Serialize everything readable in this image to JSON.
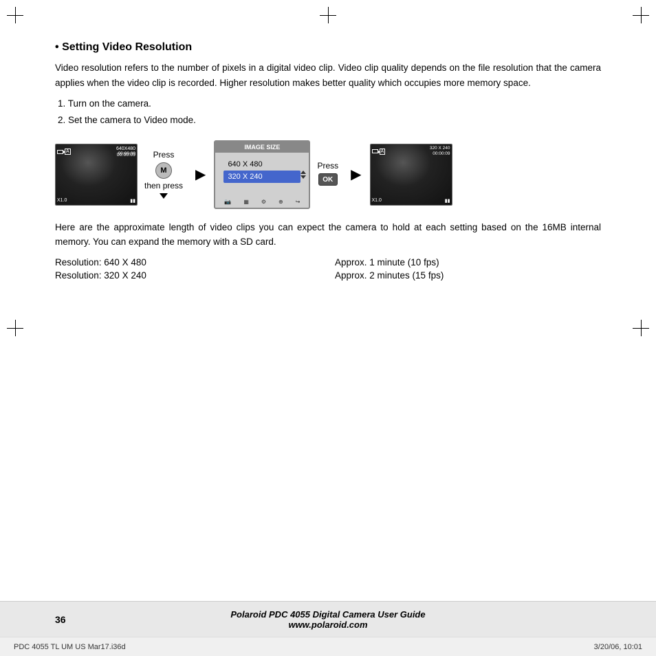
{
  "page": {
    "title": "Setting Video Resolution",
    "bullet": "•",
    "body1": "Video resolution refers to the number of pixels in a digital video clip. Video clip quality depends on the file resolution that the camera applies when the video clip is recorded. Higher resolution makes better quality which occupies more memory space.",
    "step1": "1.  Turn on the camera.",
    "step2": "2.  Set the camera to Video mode.",
    "press_label1": "Press",
    "btn_m_label": "M",
    "then_press": "then press",
    "press_label2": "Press",
    "btn_ok_label": "OK",
    "menu_header": "IMAGE SIZE",
    "menu_item1": "640 X 480",
    "menu_item2": "320 X 240",
    "cam1_resolution": "640X480",
    "cam1_time": "00:00:09",
    "cam1_zoom": "X1.0",
    "cam2_resolution": "320 X 240",
    "cam2_time": "00:00:09",
    "cam2_zoom": "X1.0",
    "description": "Here are the approximate length of video clips you can expect the camera to hold at each setting based on the 16MB internal memory. You can expand the memory with a SD card.",
    "res1_label": "Resolution: 640 X 480",
    "res1_value": "Approx. 1 minute (10 fps)",
    "res2_label": "Resolution: 320 X 240",
    "res2_value": "Approx. 2 minutes (15 fps)",
    "footer": {
      "page_number": "36",
      "doc_title": "Polaroid PDC 4055 Digital Camera User Guide",
      "doc_url": "www.polaroid.com"
    },
    "meta": {
      "left": "PDC 4055 TL UM US Mar17.i36d",
      "right": "3/20/06, 10:01"
    }
  }
}
